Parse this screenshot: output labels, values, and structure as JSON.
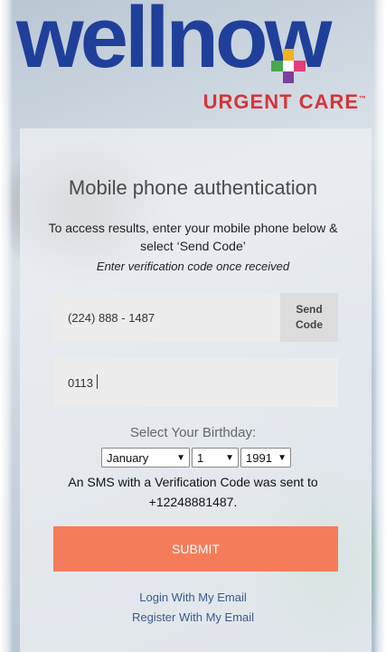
{
  "brand": {
    "wordmark": "wellnow",
    "subtitle": "URGENT CARE",
    "trademark": "™",
    "colors": {
      "wordmark": "#1f3f9a",
      "subtitle": "#d6343a",
      "submit": "#f47c5a"
    }
  },
  "auth": {
    "title": "Mobile phone authentication",
    "instruction": "To access results, enter your mobile phone below & select ‘Send Code’",
    "instruction_italic": "Enter verification code once received",
    "phone_value": "(224) 888 - 1487",
    "send_code_line1": "Send",
    "send_code_line2": "Code",
    "code_value": "0113"
  },
  "birthday": {
    "label": "Select Your Birthday:",
    "month": "January",
    "day": "1",
    "year": "1991"
  },
  "sms_notice": "An SMS with a Verification Code was sent to +12248881487.",
  "submit_label": "SUBMIT",
  "links": {
    "login_email": "Login With My Email",
    "register_email": "Register With My Email"
  }
}
